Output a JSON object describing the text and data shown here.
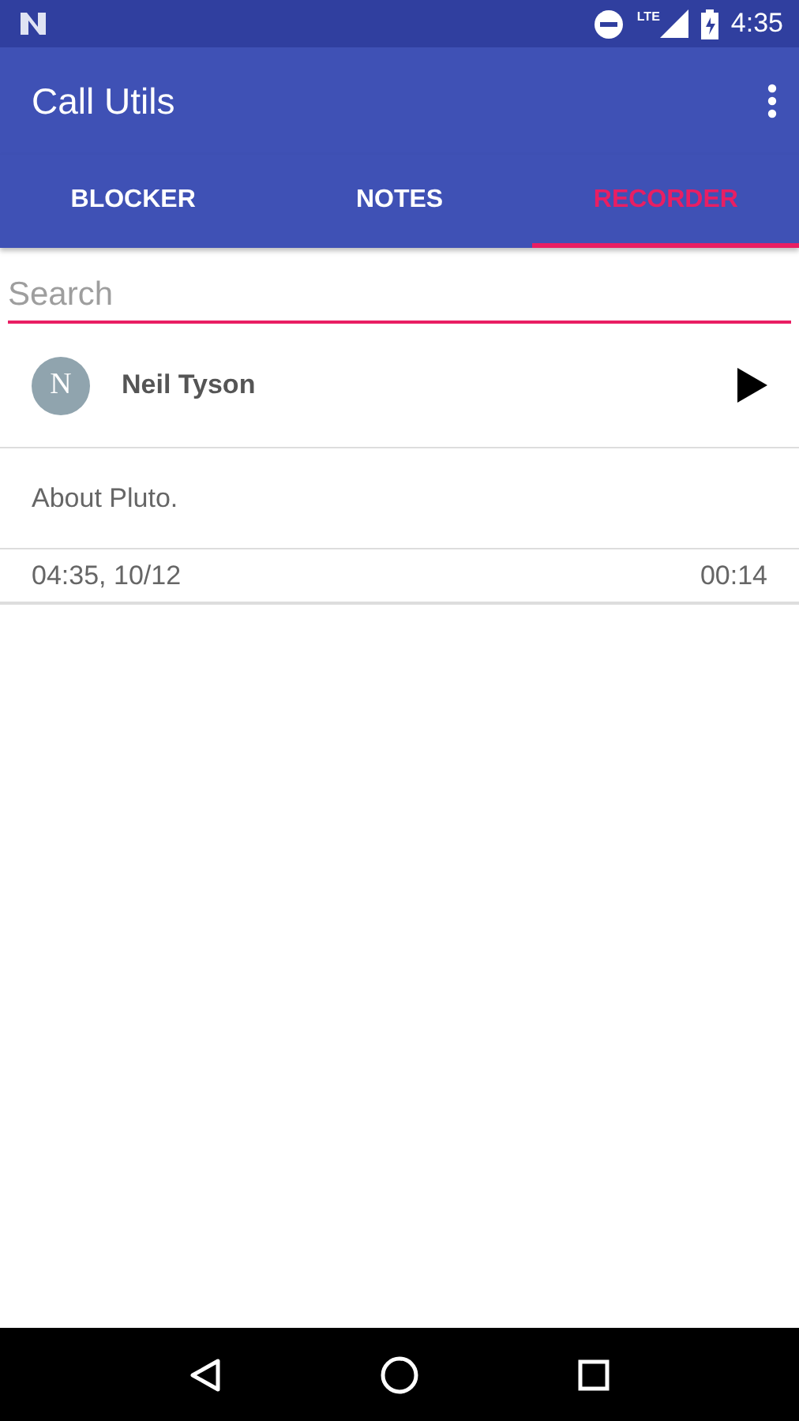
{
  "status_bar": {
    "time": "4:35",
    "network": "LTE"
  },
  "app_bar": {
    "title": "Call Utils"
  },
  "tabs": [
    {
      "label": "BLOCKER",
      "selected": false
    },
    {
      "label": "NOTES",
      "selected": false
    },
    {
      "label": "RECORDER",
      "selected": true
    }
  ],
  "search": {
    "placeholder": "Search"
  },
  "recordings": [
    {
      "initial": "N",
      "name": "Neil Tyson",
      "note": "About Pluto.",
      "date": "04:35, 10/12",
      "duration": "00:14"
    }
  ]
}
